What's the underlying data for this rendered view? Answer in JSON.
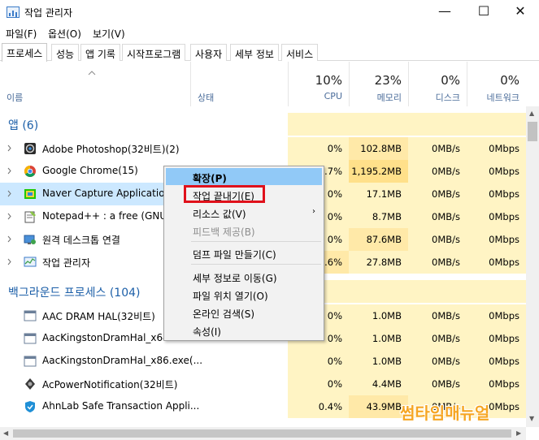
{
  "window": {
    "title": "작업 관리자",
    "minimize": "—",
    "maximize": "☐",
    "close": "✕"
  },
  "menu": [
    "파일(F)",
    "옵션(O)",
    "보기(V)"
  ],
  "tabs": [
    "프로세스",
    "성능",
    "앱 기록",
    "시작프로그램",
    "사용자",
    "세부 정보",
    "서비스"
  ],
  "active_tab": "프로세스",
  "header": {
    "name_col": "이름",
    "status_col": "상태",
    "cpu": {
      "pct": "10%",
      "label": "CPU"
    },
    "mem": {
      "pct": "23%",
      "label": "메모리"
    },
    "disk": {
      "pct": "0%",
      "label": "디스크"
    },
    "net": {
      "pct": "0%",
      "label": "네트워크"
    }
  },
  "groups": {
    "apps": "앱 (6)",
    "background": "백그라운드 프로세스 (104)"
  },
  "rows": [
    {
      "name": "Adobe Photoshop(32비트)(2)",
      "cpu": "0%",
      "mem": "102.8MB",
      "disk": "0MB/s",
      "net": "0Mbps",
      "icon": "photoshop-icon",
      "expandable": true
    },
    {
      "name": "Google Chrome(15)",
      "cpu": "0.7%",
      "mem": "1,195.2MB",
      "disk": "0MB/s",
      "net": "0Mbps",
      "icon": "chrome-icon",
      "expandable": true
    },
    {
      "name": "Naver Capture Application(32",
      "cpu": "0%",
      "mem": "17.1MB",
      "disk": "0MB/s",
      "net": "0Mbps",
      "icon": "naver-capture-icon",
      "expandable": true
    },
    {
      "name": "Notepad++ : a free (GNU) so",
      "cpu": "0%",
      "mem": "8.7MB",
      "disk": "0MB/s",
      "net": "0Mbps",
      "icon": "notepad-icon",
      "expandable": true
    },
    {
      "name": "원격 데스크톱 연결",
      "cpu": "0%",
      "mem": "87.6MB",
      "disk": "0MB/s",
      "net": "0Mbps",
      "icon": "remote-desktop-icon",
      "expandable": true
    },
    {
      "name": "작업 관리자",
      "cpu": "7.6%",
      "mem": "27.8MB",
      "disk": "0MB/s",
      "net": "0Mbps",
      "icon": "task-manager-icon",
      "expandable": true
    },
    {
      "name": "AAC DRAM HAL(32비트)",
      "cpu": "0%",
      "mem": "1.0MB",
      "disk": "0MB/s",
      "net": "0Mbps",
      "icon": "process-icon",
      "expandable": false
    },
    {
      "name": "AacKingstonDramHal_x64.exe",
      "cpu": "0%",
      "mem": "1.0MB",
      "disk": "0MB/s",
      "net": "0Mbps",
      "icon": "process-icon",
      "expandable": false
    },
    {
      "name": "AacKingstonDramHal_x86.exe(...",
      "cpu": "0%",
      "mem": "1.0MB",
      "disk": "0MB/s",
      "net": "0Mbps",
      "icon": "process-icon",
      "expandable": false
    },
    {
      "name": "AcPowerNotification(32비트)",
      "cpu": "0%",
      "mem": "4.4MB",
      "disk": "0MB/s",
      "net": "0Mbps",
      "icon": "power-notification-icon",
      "expandable": false
    },
    {
      "name": "AhnLab Safe Transaction Appli...",
      "cpu": "0.4%",
      "mem": "43.9MB",
      "disk": "0MB/s",
      "net": "0Mbps",
      "icon": "ahnlab-shield-icon",
      "expandable": false
    }
  ],
  "context_menu": {
    "items": [
      {
        "label": "확장(P)",
        "state": "highlighted"
      },
      {
        "label": "작업 끝내기(E)",
        "state": "normal"
      },
      {
        "label": "리소스 값(V)",
        "state": "submenu"
      },
      {
        "label": "피드백 제공(B)",
        "state": "disabled"
      },
      {
        "label": "덤프 파일 만들기(C)",
        "state": "normal"
      },
      {
        "label": "세부 정보로 이동(G)",
        "state": "normal"
      },
      {
        "label": "파일 위치 열기(O)",
        "state": "normal"
      },
      {
        "label": "온라인 검색(S)",
        "state": "normal"
      },
      {
        "label": "속성(I)",
        "state": "normal"
      }
    ],
    "submenu_arrow": "›"
  },
  "watermark": "썸타임매뉴얼",
  "colors": {
    "selection": "#cce8ff",
    "heat_light": "#fff4c4",
    "heat_medium": "#ffe9a8",
    "highlight": "#91c9f7",
    "callout_red": "#e0111b",
    "watermark": "#f6a623"
  }
}
